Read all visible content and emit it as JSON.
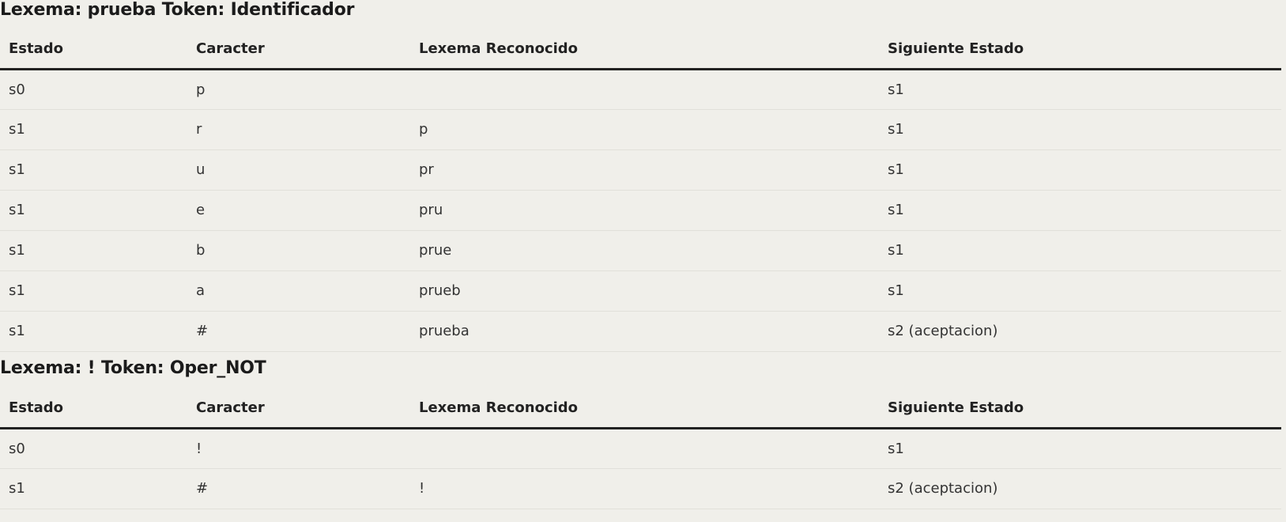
{
  "sections": [
    {
      "title": "Lexema: prueba Token: Identificador",
      "headers": [
        "Estado",
        "Caracter",
        "Lexema Reconocido",
        "Siguiente Estado"
      ],
      "rows": [
        [
          "s0",
          "p",
          "",
          "s1"
        ],
        [
          "s1",
          "r",
          "p",
          "s1"
        ],
        [
          "s1",
          "u",
          "pr",
          "s1"
        ],
        [
          "s1",
          "e",
          "pru",
          "s1"
        ],
        [
          "s1",
          "b",
          "prue",
          "s1"
        ],
        [
          "s1",
          "a",
          "prueb",
          "s1"
        ],
        [
          "s1",
          "#",
          "prueba",
          "s2 (aceptacion)"
        ]
      ]
    },
    {
      "title": "Lexema: ! Token: Oper_NOT",
      "headers": [
        "Estado",
        "Caracter",
        "Lexema Reconocido",
        "Siguiente Estado"
      ],
      "rows": [
        [
          "s0",
          "!",
          "",
          "s1"
        ],
        [
          "s1",
          "#",
          "!",
          "s2 (aceptacion)"
        ]
      ]
    }
  ]
}
